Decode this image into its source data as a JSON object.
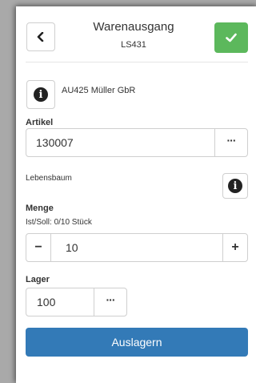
{
  "header": {
    "title": "Warenausgang",
    "subtitle": "LS431"
  },
  "customer": {
    "text": "AU425 Müller GbR"
  },
  "article": {
    "label": "Artikel",
    "value": "130007",
    "lookup": "···",
    "name": "Lebensbaum"
  },
  "quantity": {
    "label": "Menge",
    "info": "Ist/Soll: 0/10 Stück",
    "minus": "−",
    "value": "10",
    "plus": "+"
  },
  "storage": {
    "label": "Lager",
    "value": "100",
    "lookup": "···"
  },
  "submit": {
    "label": "Auslagern"
  },
  "icons": {
    "back": "chevron-left",
    "confirm": "check",
    "info": "info-circle"
  },
  "colors": {
    "confirm": "#5cb85c",
    "primary": "#337ab7"
  }
}
